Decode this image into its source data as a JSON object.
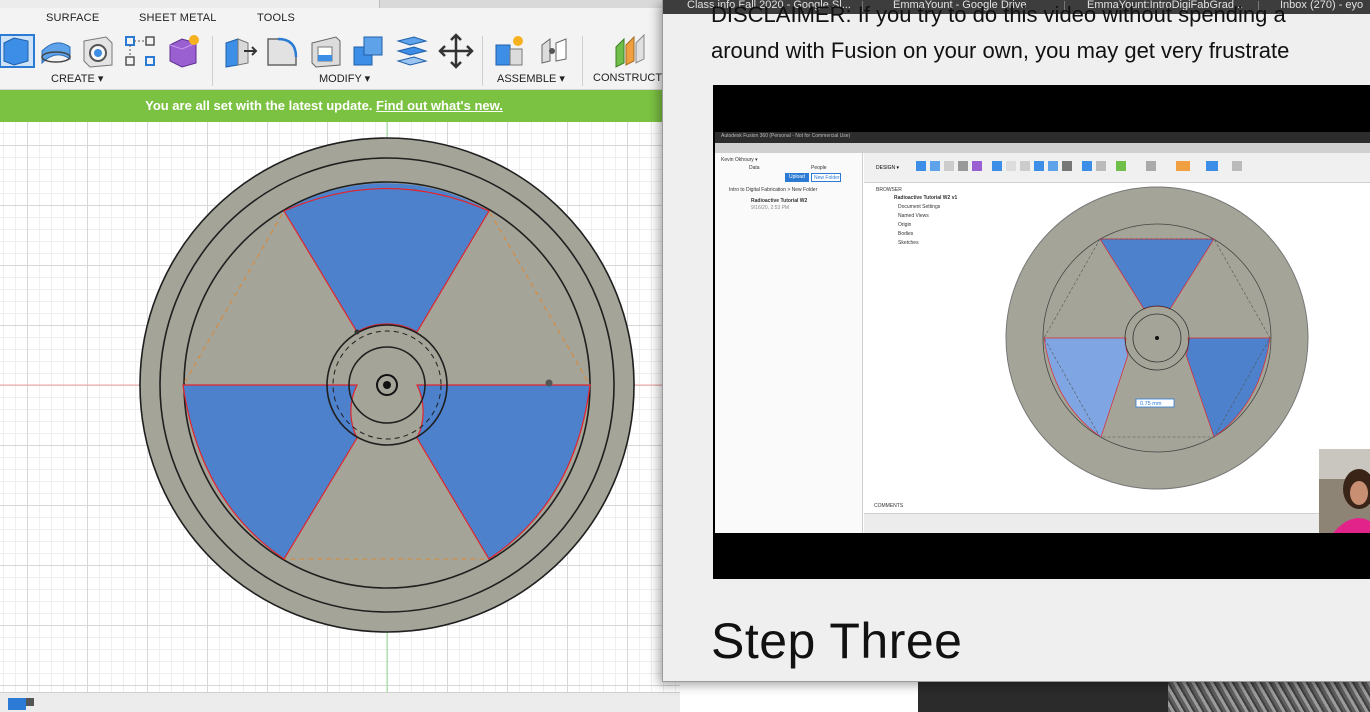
{
  "fusion": {
    "ribbon": {
      "tabs": [
        "SURFACE",
        "SHEET METAL",
        "TOOLS"
      ],
      "groups": {
        "create": "CREATE ▾",
        "modify": "MODIFY ▾",
        "assemble": "ASSEMBLE ▾",
        "construct": "CONSTRUCT"
      },
      "tools": [
        "new-component-icon",
        "sweep-icon",
        "hole-icon",
        "rectangular-pattern-icon",
        "create-form-icon",
        "press-pull-icon",
        "fillet-icon",
        "shell-icon",
        "combine-icon",
        "replace-face-icon",
        "move-icon",
        "new-joint-icon",
        "as-built-joint-icon",
        "offset-plane-icon"
      ]
    },
    "banner": {
      "text": "You are all set with the latest update.",
      "link": "Find out what's new."
    },
    "colors": {
      "banner": "#7cc242",
      "disc": "#a4a598",
      "blade": "#4d81cc",
      "profile_line": "#e2242c",
      "construction_line": "#d98a3c"
    }
  },
  "browser": {
    "tabs": [
      "Class info Fall 2020 - Google Sl...",
      "EmmaYount - Google Drive",
      "EmmaYount:IntroDigiFabGrad...",
      "Inbox (270) - eyo"
    ],
    "disclaimer_line1": "DISCLAIMER: If you try to do this video without spending a",
    "disclaimer_line2": "around with Fusion on your own, you may get very frustrate",
    "step_title": "Step Three"
  },
  "video": {
    "top_title": "Autodesk Fusion 360 (Personal - Not for Commercial Use)",
    "user": "Kevin Okhoury ▾",
    "data_tab": "Data",
    "people_tab": "People",
    "upload_label": "Upload",
    "new_folder_label": "New Folder",
    "breadcrumb": "Intro to Digital Fabrication  >  New Folder",
    "file_name": "Radioactive Tutorial W2",
    "file_date": "9/16/20, 2:53 PM",
    "design_label": "DESIGN ▾",
    "browser_label": "BROWSER",
    "browser_items": [
      "Radioactive Tutorial W2 v1",
      "Document Settings",
      "Named Views",
      "Origin",
      "Bodies",
      "Sketches"
    ],
    "comments_label": "COMMENTS",
    "dimension_value": "0.75 mm"
  }
}
